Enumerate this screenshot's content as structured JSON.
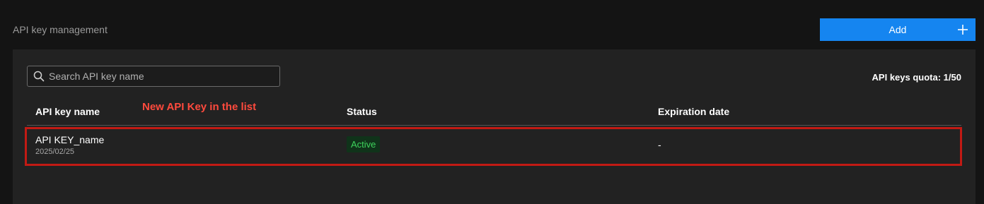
{
  "header": {
    "title": "API key management",
    "add_label": "Add",
    "add_icon": "plus-icon"
  },
  "search": {
    "placeholder": "Search API key name",
    "value": "",
    "icon": "search-icon"
  },
  "quota": {
    "text": "API keys quota: 1/50"
  },
  "table": {
    "columns": [
      "API key name",
      "Status",
      "Expiration date"
    ],
    "rows": [
      {
        "name": "API KEY_name",
        "created": "2025/02/25",
        "status": "Active",
        "expiration": "-"
      }
    ]
  },
  "annotation": {
    "text": "New API Key in the list",
    "color": "#ff4a3d",
    "box_color": "#c21a14"
  },
  "colors": {
    "accent": "#1585f0",
    "status_active_text": "#3ed35c",
    "status_active_bg": "#10331a"
  }
}
